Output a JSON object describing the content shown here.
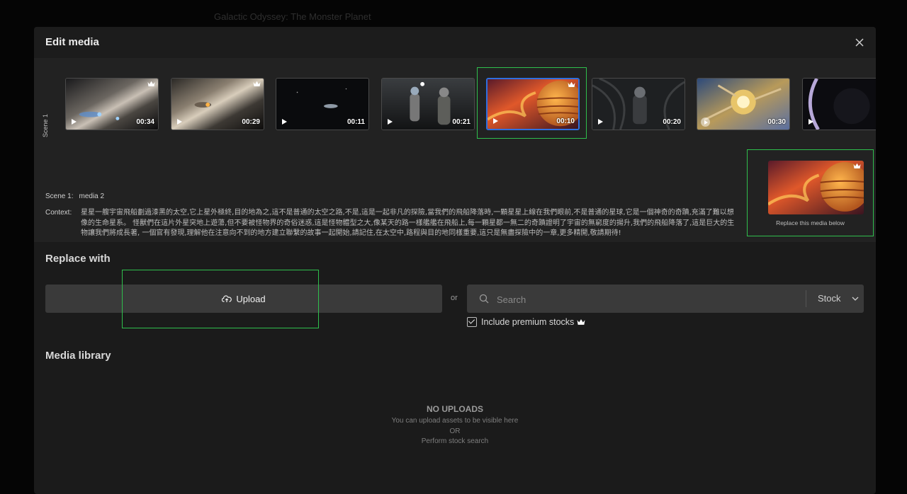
{
  "background": {
    "project_title": "Galactic Odyssey: The Monster Planet"
  },
  "modal": {
    "title": "Edit media",
    "scene_vertical_label": "Scene 1",
    "thumbnails": [
      {
        "duration": "00:34",
        "premium": true,
        "play_style": "triangle",
        "theme": "galaxy-ships"
      },
      {
        "duration": "00:29",
        "premium": true,
        "play_style": "triangle",
        "theme": "ship-thrusters"
      },
      {
        "duration": "00:11",
        "premium": false,
        "play_style": "triangle",
        "theme": "dark-ship"
      },
      {
        "duration": "00:21",
        "premium": false,
        "play_style": "triangle",
        "theme": "astronauts-cave"
      },
      {
        "duration": "00:10",
        "premium": true,
        "play_style": "triangle",
        "theme": "fire-planet",
        "selected": true
      },
      {
        "duration": "00:20",
        "premium": false,
        "play_style": "triangle",
        "theme": "astronaut-tentacles"
      },
      {
        "duration": "00:30",
        "premium": false,
        "play_style": "circle",
        "theme": "golden-station"
      },
      {
        "duration": "",
        "premium": false,
        "play_style": "triangle",
        "theme": "dark-planet"
      }
    ],
    "scene_label": "Scene 1:",
    "scene_value": "media 2",
    "context_label": "Context:",
    "context_text": "星星一艘宇宙飛船劃過漆黑的太空,它上星外極終,目的地為之,這不是普通的太空之路,不是,這是一起非凡的探險,當我們的飛船降落時,一顆星星上線在我們眼前,不是普通的星球,它是一個神奇的奇蹟,充滿了難以想像的生命星系。 怪獸們在這片外星突地上遊蕩,但不要被怪物界的奇俗迷惑,這是怪物體型之大,像某天的路一樣艦艦在飛船上,每一顆星都一無二的奇蹟證明了宇宙的無窮度的揚升,我們的飛船降落了,這是巨大的生物讓我們將成長著, 一個官有發現,理解他在注意向不到的地方建立聯繫的故事一起開始,請記住,在太空中,路程與目的地同樣重要,這只是無盡探險中的一章,更多精開,敬請期待!",
    "replace_caption": "Replace this media below",
    "replace_with_title": "Replace with",
    "upload_label": "Upload",
    "or_label": "or",
    "search_placeholder": "Search",
    "stock_select_value": "Stock",
    "include_premium_label": "Include premium stocks",
    "include_premium_checked": true,
    "media_library_title": "Media library",
    "empty_title": "NO UPLOADS",
    "empty_line1": "You can upload assets to be visible here",
    "empty_line2": "OR",
    "empty_line3": "Perform stock search"
  },
  "colors": {
    "highlight": "#2fbf4d",
    "selected_border": "#2f6fe0",
    "button_bg": "#3a3a3a"
  }
}
